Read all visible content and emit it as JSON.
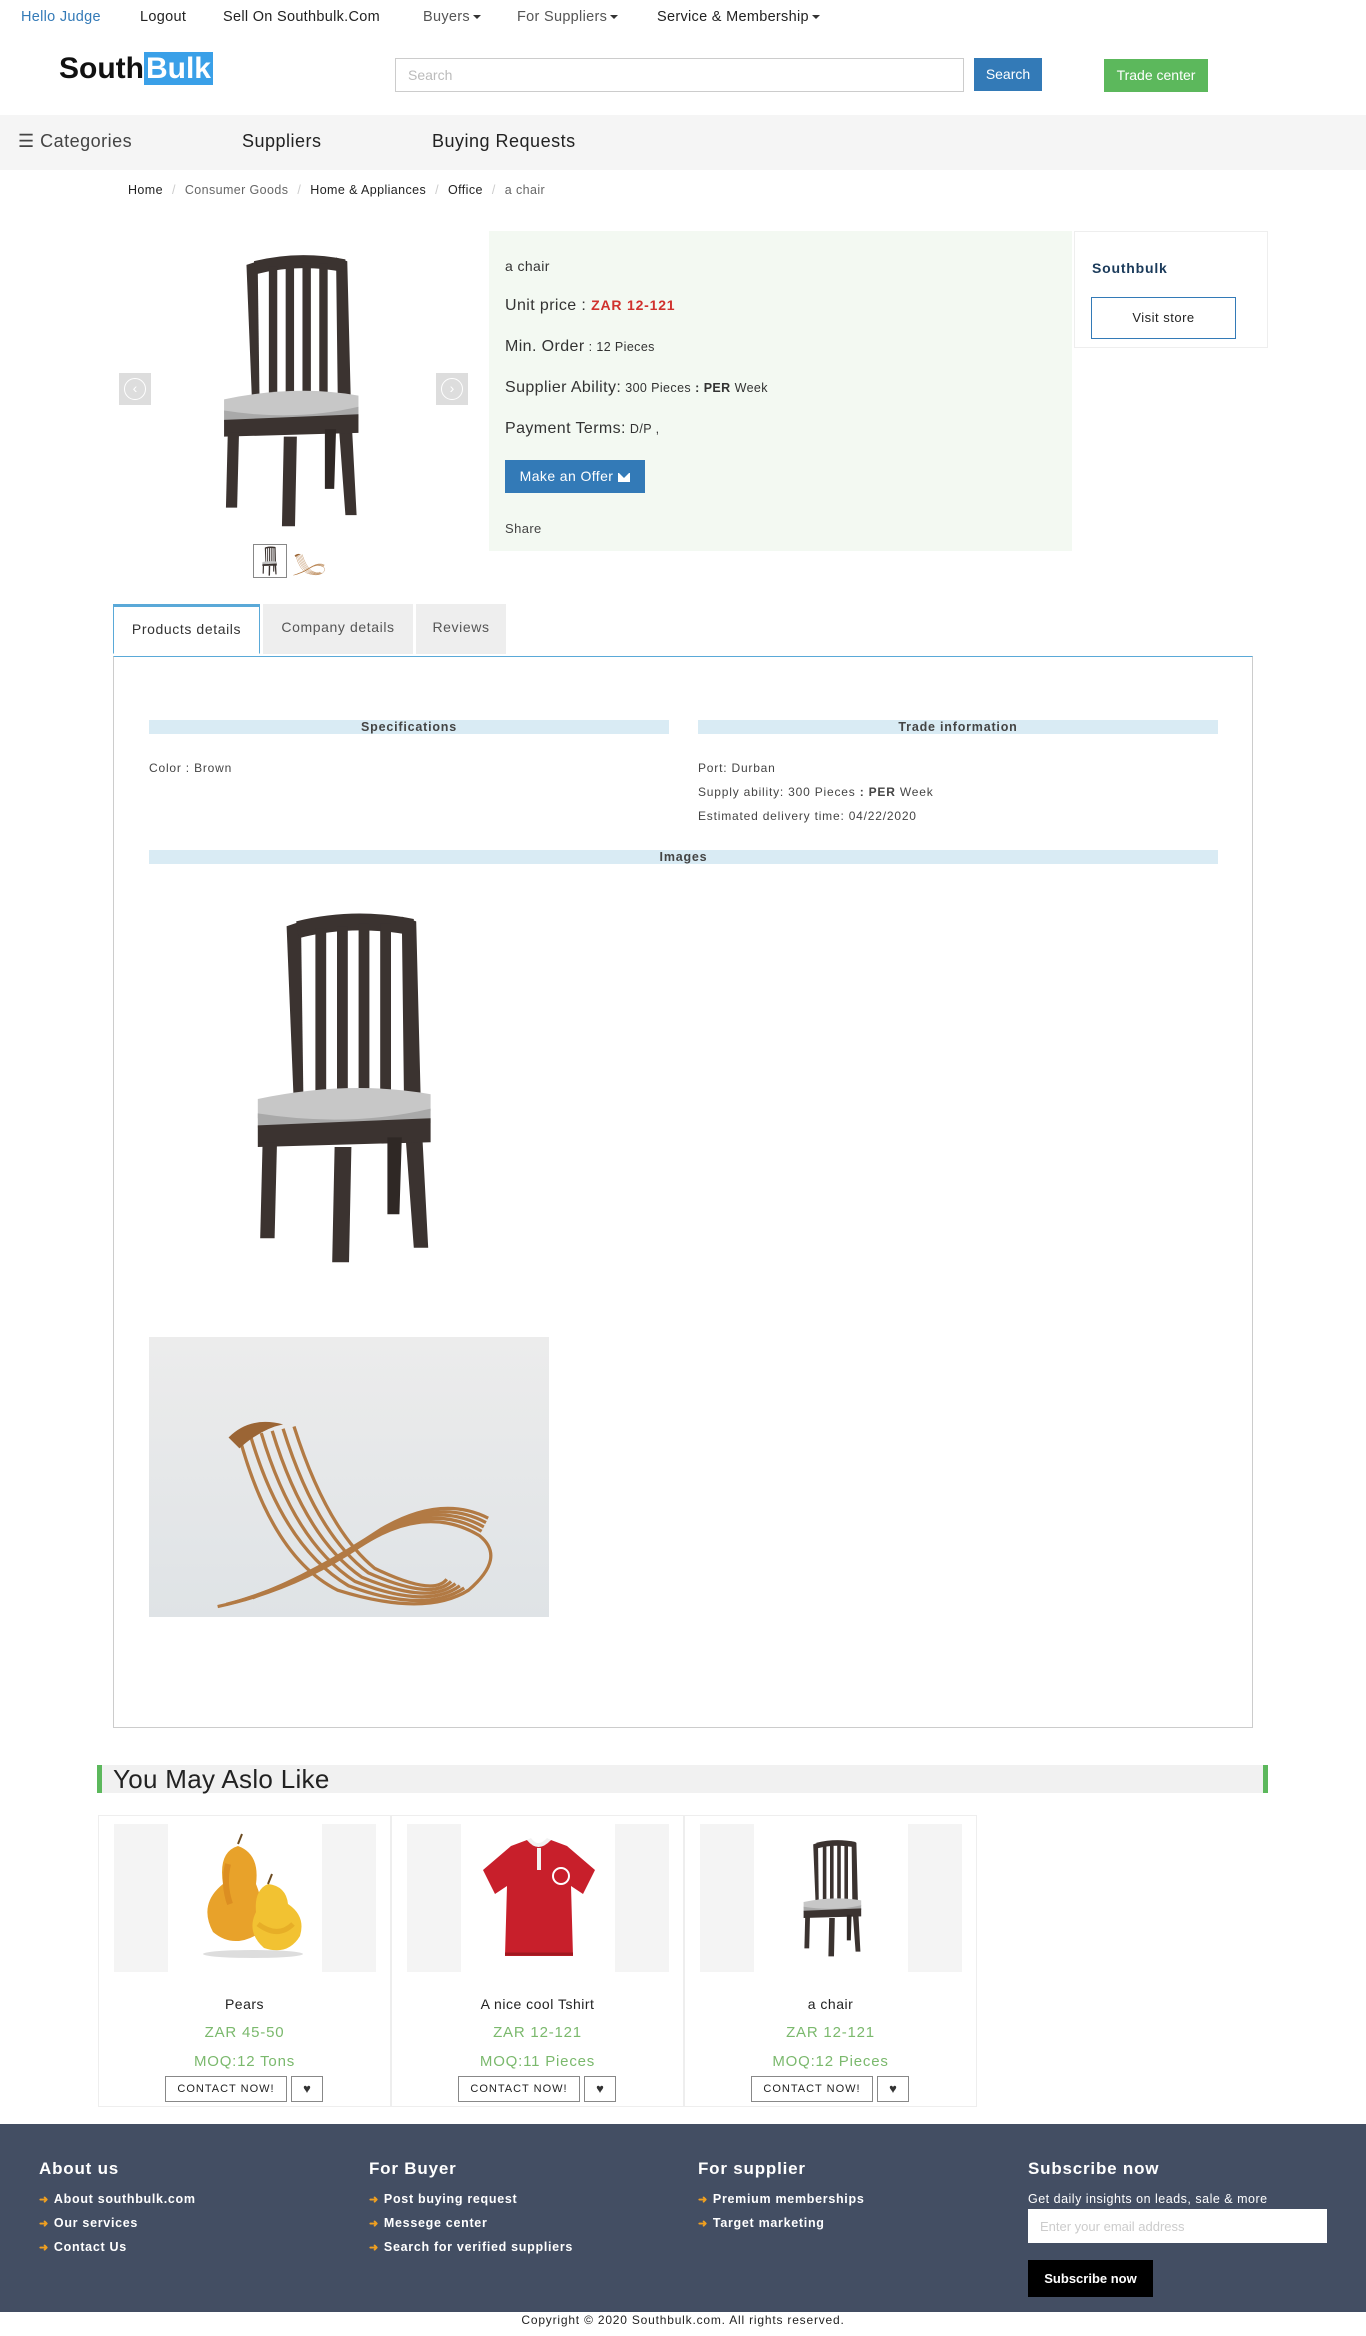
{
  "topnav": {
    "hello": "Hello Judge",
    "logout": "Logout",
    "sell": "Sell On Southbulk.Com",
    "buyers": "Buyers",
    "for_suppliers": "For Suppliers",
    "service": "Service & Membership"
  },
  "logo": {
    "part1": "South",
    "part2": "Bulk"
  },
  "search": {
    "placeholder": "Search",
    "button": "Search"
  },
  "trade_center": "Trade center",
  "catbar": {
    "categories": "☰ Categories",
    "suppliers": "Suppliers",
    "buying_requests": "Buying Requests"
  },
  "breadcrumb": [
    "Home",
    "Consumer Goods",
    "Home & Appliances",
    "Office",
    "a chair"
  ],
  "product": {
    "name": "a chair",
    "unit_price_label": "Unit price : ",
    "unit_price_value": "ZAR 12-121",
    "min_order_label": "Min. Order",
    "min_order_value": ": 12 Pieces",
    "supplier_ability_label": "Supplier Ability:",
    "supplier_ability_value": "300 Pieces",
    "supplier_ability_sep": ":",
    "supplier_ability_per": "PER",
    "supplier_ability_unit": "Week",
    "payment_label": "Payment Terms:",
    "payment_value": "D/P ,",
    "offer_button": "Make an Offer",
    "share": "Share"
  },
  "store": {
    "name": "Southbulk",
    "visit": "Visit store"
  },
  "tabs": {
    "products": "Products details",
    "company": "Company details",
    "reviews": "Reviews"
  },
  "details": {
    "specifications_title": "Specifications",
    "trade_title": "Trade information",
    "images_title": "Images",
    "color": "Color : Brown",
    "port": "Port: Durban",
    "supply_prefix": "Supply ability: 300 Pieces",
    "supply_sep": ":",
    "supply_per": "PER",
    "supply_unit": "Week",
    "delivery": "Estimated delivery time: 04/22/2020"
  },
  "ymal": {
    "title": "You May Aslo Like",
    "cards": [
      {
        "name": "Pears",
        "price": "ZAR 45-50",
        "moq": "MOQ:12 Tons",
        "contact": "CONTACT NOW!"
      },
      {
        "name": "A nice cool Tshirt",
        "price": "ZAR 12-121",
        "moq": "MOQ:11 Pieces",
        "contact": "CONTACT NOW!"
      },
      {
        "name": "a chair",
        "price": "ZAR 12-121",
        "moq": "MOQ:12 Pieces",
        "contact": "CONTACT NOW!"
      }
    ]
  },
  "footer": {
    "about_title": "About us",
    "about_links": [
      "About southbulk.com",
      "Our services",
      "Contact Us"
    ],
    "buyer_title": "For Buyer",
    "buyer_links": [
      "Post buying request",
      "Messege center",
      "Search for verified suppliers"
    ],
    "supplier_title": "For supplier",
    "supplier_links": [
      "Premium memberships",
      "Target marketing"
    ],
    "subscribe_title": "Subscribe now",
    "subscribe_desc": "Get daily insights on leads, sale & more",
    "email_placeholder": "Enter your email address",
    "subscribe_button": "Subscribe now"
  },
  "copyright": "Copyright © 2020 Southbulk.com. All rights reserved.",
  "colors": {
    "brand_blue": "#337ab7",
    "logo_blue": "#3aa0e8",
    "trade_green": "#5cb85c",
    "price_red": "#d0312d",
    "footer_bg": "#434e63",
    "card_green": "#7bb96d"
  }
}
